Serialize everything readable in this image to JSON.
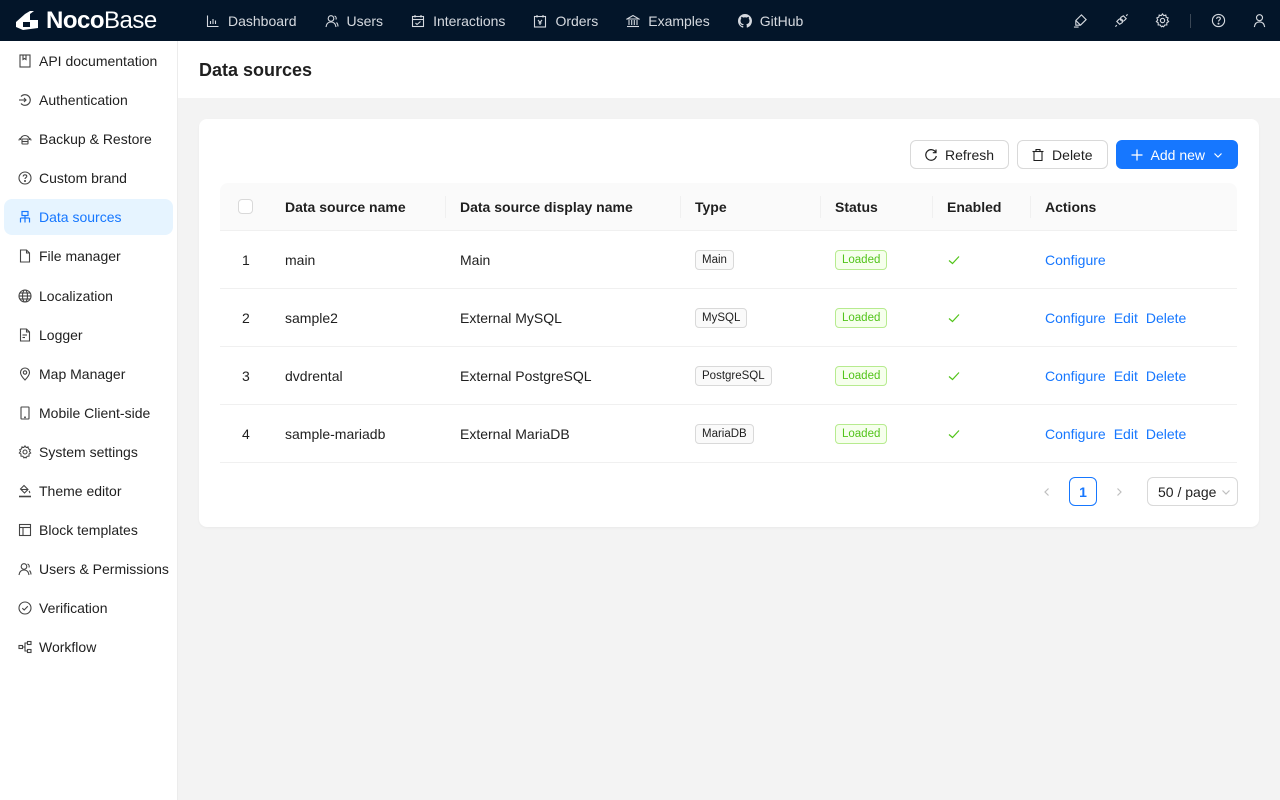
{
  "app": {
    "logo_strong": "Noco",
    "logo_light": "Base"
  },
  "topnav": {
    "items": [
      {
        "label": "Dashboard",
        "icon": "bar-chart-icon"
      },
      {
        "label": "Users",
        "icon": "users-icon"
      },
      {
        "label": "Interactions",
        "icon": "calendar-icon"
      },
      {
        "label": "Orders",
        "icon": "order-icon"
      },
      {
        "label": "Examples",
        "icon": "bank-icon"
      },
      {
        "label": "GitHub",
        "icon": "github-icon"
      }
    ],
    "right_icons": [
      "highlighter-icon",
      "plugin-icon",
      "gear-icon",
      "help-icon",
      "user-icon"
    ]
  },
  "sidebar": {
    "items": [
      {
        "label": "API documentation",
        "icon": "book-icon",
        "active": false
      },
      {
        "label": "Authentication",
        "icon": "login-icon",
        "active": false
      },
      {
        "label": "Backup & Restore",
        "icon": "cloud-server-icon",
        "active": false
      },
      {
        "label": "Custom brand",
        "icon": "question-circle-icon",
        "active": false
      },
      {
        "label": "Data sources",
        "icon": "cluster-icon",
        "active": true
      },
      {
        "label": "File manager",
        "icon": "file-icon",
        "active": false
      },
      {
        "label": "Localization",
        "icon": "global-icon",
        "active": false
      },
      {
        "label": "Logger",
        "icon": "file-text-icon",
        "active": false
      },
      {
        "label": "Map Manager",
        "icon": "environment-icon",
        "active": false
      },
      {
        "label": "Mobile Client-side",
        "icon": "mobile-icon",
        "active": false
      },
      {
        "label": "System settings",
        "icon": "setting-icon",
        "active": false
      },
      {
        "label": "Theme editor",
        "icon": "bg-colors-icon",
        "active": false
      },
      {
        "label": "Block templates",
        "icon": "layout-icon",
        "active": false
      },
      {
        "label": "Users & Permissions",
        "icon": "users-icon",
        "active": false
      },
      {
        "label": "Verification",
        "icon": "check-circle-icon",
        "active": false
      },
      {
        "label": "Workflow",
        "icon": "partition-icon",
        "active": false
      }
    ]
  },
  "page": {
    "title": "Data sources"
  },
  "toolbar": {
    "refresh_label": "Refresh",
    "delete_label": "Delete",
    "add_new_label": "Add new"
  },
  "table": {
    "columns": [
      "Data source name",
      "Data source display name",
      "Type",
      "Status",
      "Enabled",
      "Actions"
    ],
    "rows": [
      {
        "index": "1",
        "name": "main",
        "display_name": "Main",
        "type": "Main",
        "status": "Loaded",
        "enabled": true,
        "actions": [
          "Configure"
        ]
      },
      {
        "index": "2",
        "name": "sample2",
        "display_name": "External MySQL",
        "type": "MySQL",
        "status": "Loaded",
        "enabled": true,
        "actions": [
          "Configure",
          "Edit",
          "Delete"
        ]
      },
      {
        "index": "3",
        "name": "dvdrental",
        "display_name": "External PostgreSQL",
        "type": "PostgreSQL",
        "status": "Loaded",
        "enabled": true,
        "actions": [
          "Configure",
          "Edit",
          "Delete"
        ]
      },
      {
        "index": "4",
        "name": "sample-mariadb",
        "display_name": "External MariaDB",
        "type": "MariaDB",
        "status": "Loaded",
        "enabled": true,
        "actions": [
          "Configure",
          "Edit",
          "Delete"
        ]
      }
    ]
  },
  "pagination": {
    "current_page": "1",
    "page_size": "50 / page"
  },
  "colors": {
    "topbar_bg": "#031529",
    "primary": "#1677ff",
    "success": "#52c41a",
    "active_bg": "#e6f4ff"
  }
}
